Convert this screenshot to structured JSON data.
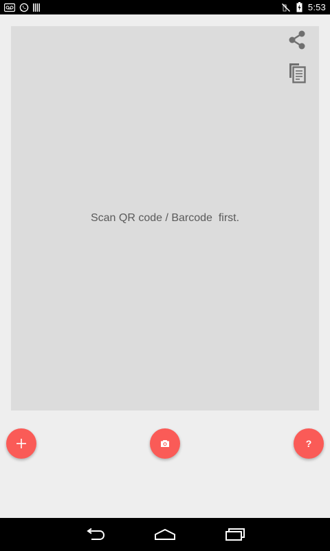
{
  "status_bar": {
    "time": "5:53",
    "left_icons": [
      "voicemail-icon",
      "whatsapp-icon",
      "signal-bars-icon"
    ],
    "right_icons": [
      "mute-icon",
      "battery-charging-icon"
    ]
  },
  "result_panel": {
    "message": "Scan QR code / Barcode  first.",
    "actions": [
      "share-icon",
      "copy-icon"
    ]
  },
  "fabs": {
    "add_icon": "plus-icon",
    "scan_icon": "camera-icon",
    "help_label": "?"
  },
  "colors": {
    "accent": "#fa5b57",
    "background": "#eeeeee",
    "panel": "#dcdcdc",
    "icon_gray": "#6f6f6f"
  },
  "nav_bar": {
    "buttons": [
      "back-icon",
      "home-icon",
      "recents-icon"
    ]
  }
}
